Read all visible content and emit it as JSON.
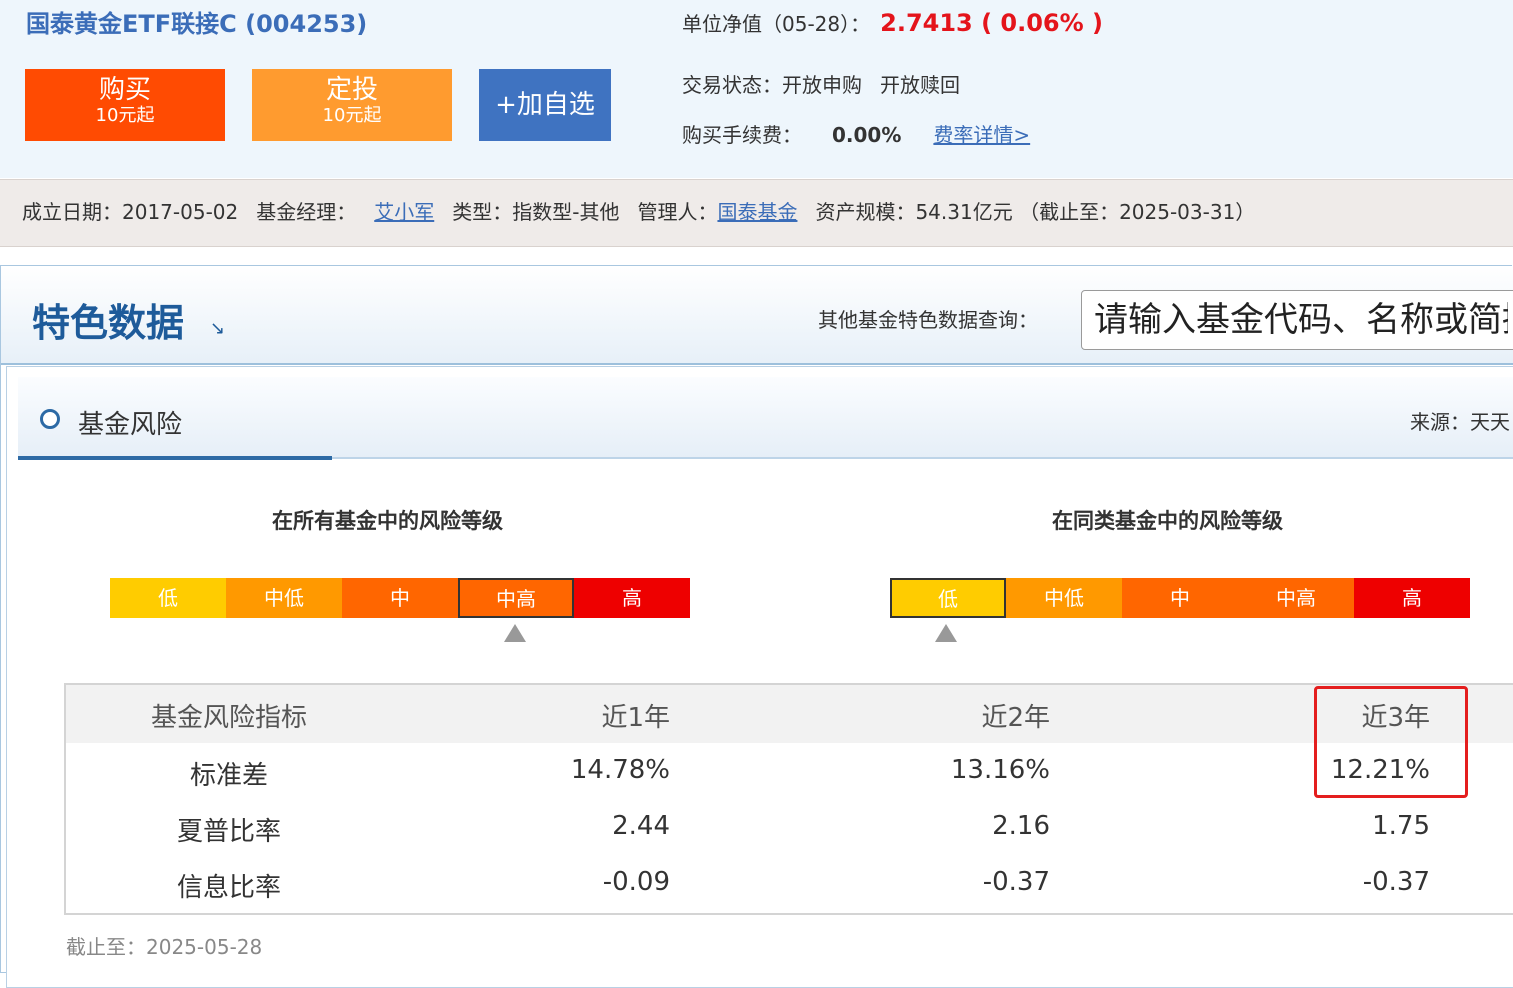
{
  "fund": {
    "title": "国泰黄金ETF联接C (004253)",
    "nav_label": "单位净值（05-28）：",
    "nav_value": "2.7413 ( 0.06% )",
    "trade_status_label": "交易状态：",
    "trade_status": [
      "开放申购",
      "开放赎回"
    ],
    "fee_label": "购买手续费：",
    "fee_value": "0.00%",
    "fee_link": "费率详情>"
  },
  "buttons": {
    "buy": {
      "label": "购买",
      "sub": "10元起"
    },
    "dingtou": {
      "label": "定投",
      "sub": "10元起"
    },
    "watchlist": {
      "label": "+加自选"
    }
  },
  "info_bar": {
    "establish_label": "成立日期：",
    "establish_date": "2017-05-02",
    "manager_label": "基金经理：",
    "manager": "艾小军",
    "type_label": "类型：",
    "type": "指数型-其他",
    "company_label": "管理人：",
    "company": "国泰基金",
    "size_label": "资产规模：",
    "size": "54.31亿元 （截止至：2025-03-31）"
  },
  "feature": {
    "title": "特色数据",
    "arrow": "↘",
    "search_label": "其他基金特色数据查询：",
    "search_placeholder": "请输入基金代码、名称或简拼"
  },
  "risk": {
    "title": "基金风险",
    "source_label": "来源：天天",
    "scale_all_title": "在所有基金中的风险等级",
    "scale_peer_title": "在同类基金中的风险等级",
    "levels": [
      "低",
      "中低",
      "中",
      "中高",
      "高"
    ],
    "level_all": "中高",
    "level_peer": "低",
    "colors": {
      "low": "#ffcc00",
      "mid_low": "#ff9900",
      "mid": "#ff6600",
      "mid_high": "#ff6600",
      "high": "#ee0000"
    },
    "table": {
      "headers": [
        "基金风险指标",
        "近1年",
        "近2年",
        "近3年"
      ],
      "rows": [
        [
          "标准差",
          "14.78%",
          "13.16%",
          "12.21%"
        ],
        [
          "夏普比率",
          "2.44",
          "2.16",
          "1.75"
        ],
        [
          "信息比率",
          "-0.09",
          "-0.37",
          "-0.37"
        ]
      ]
    },
    "as_of": "截止至：2025-05-28"
  }
}
